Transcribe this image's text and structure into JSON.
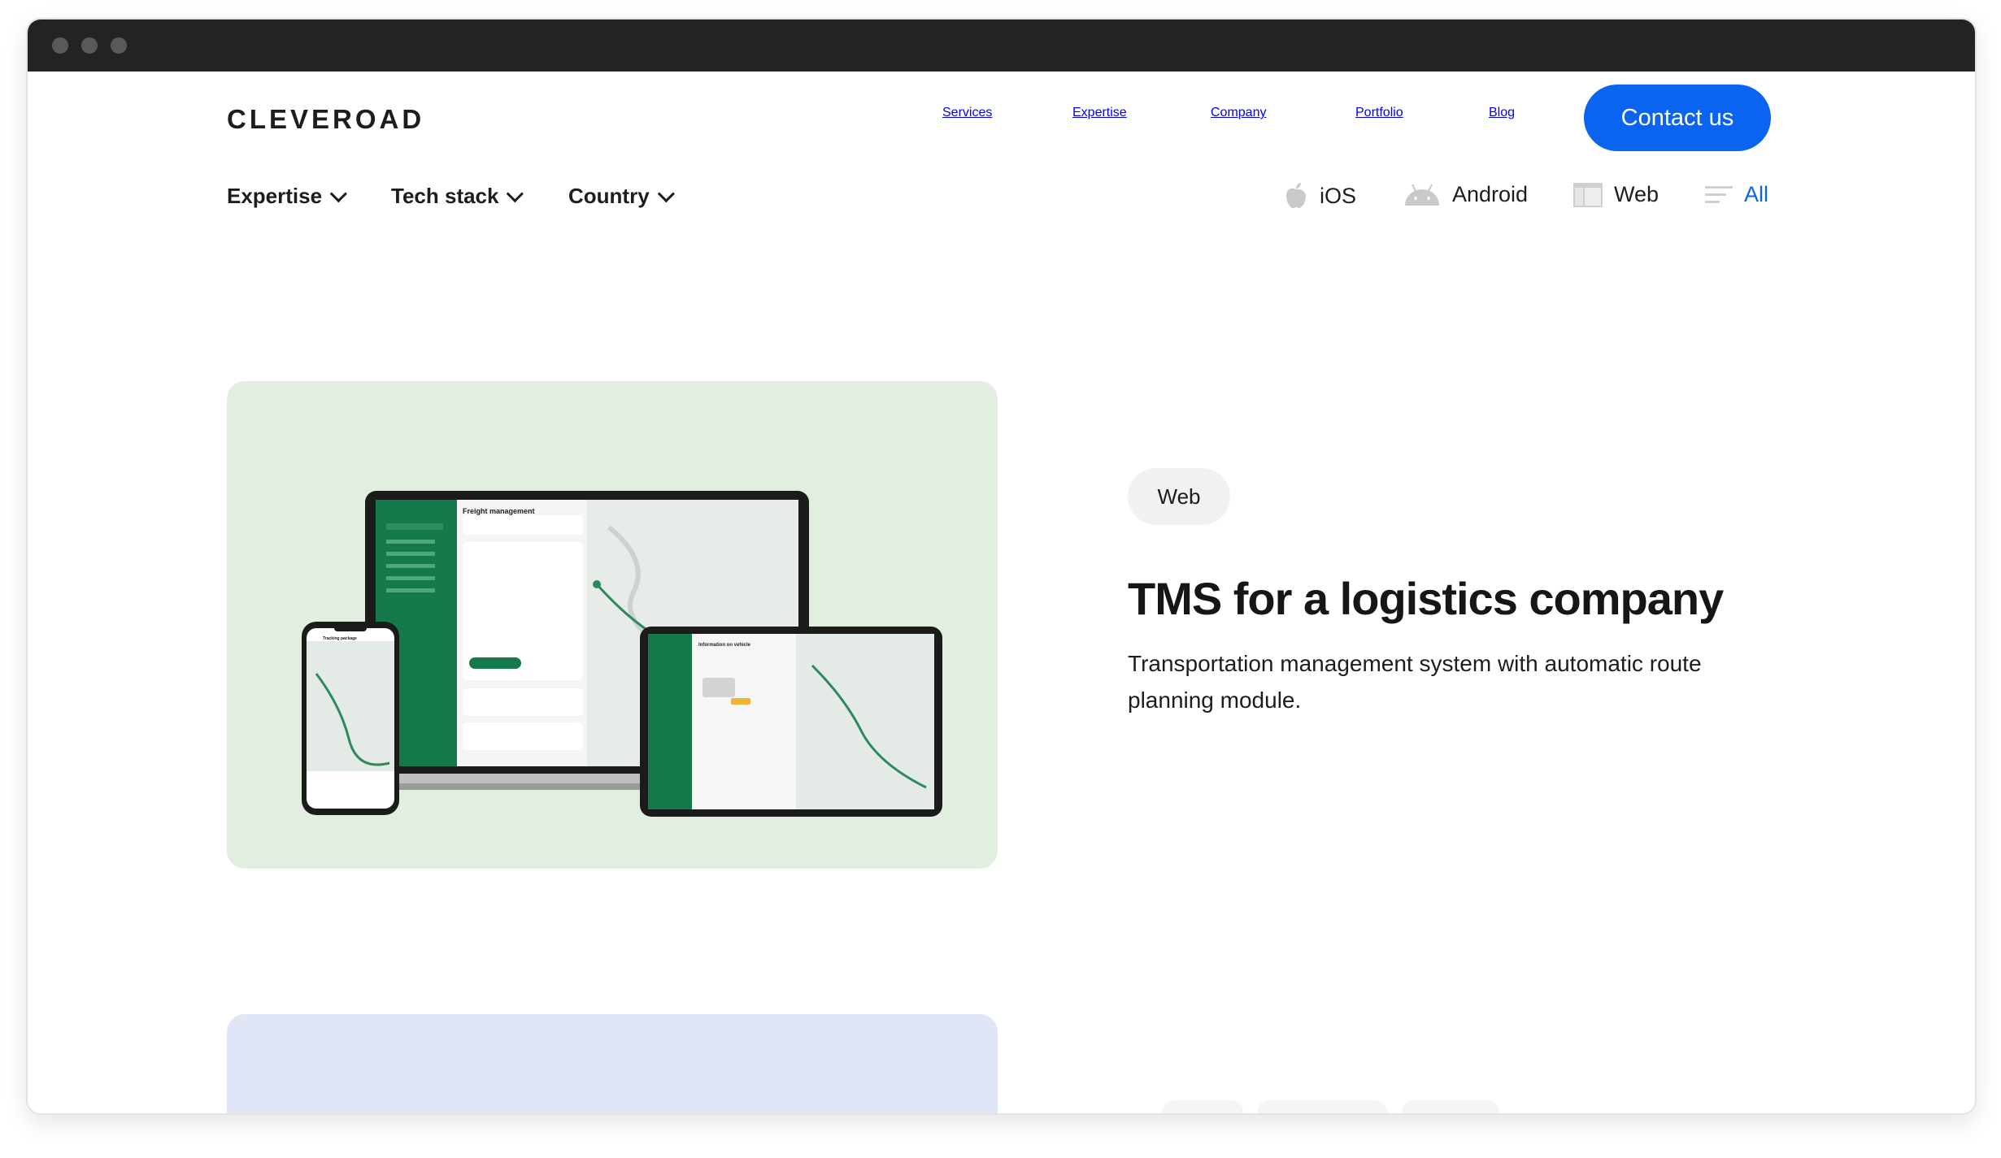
{
  "brand": {
    "logo": "CLEVEROAD"
  },
  "nav": {
    "items": [
      "Services",
      "Expertise",
      "Company",
      "Portfolio",
      "Blog"
    ],
    "contact": "Contact us"
  },
  "filters": [
    {
      "label": "Expertise"
    },
    {
      "label": "Tech stack"
    },
    {
      "label": "Country"
    }
  ],
  "platforms": [
    {
      "label": "iOS",
      "icon": "apple-icon"
    },
    {
      "label": "Android",
      "icon": "android-icon"
    },
    {
      "label": "Web",
      "icon": "web-icon"
    },
    {
      "label": "All",
      "icon": "all-icon",
      "active": true
    }
  ],
  "project": {
    "tag": "Web",
    "title": "TMS for a logistics company",
    "description": "Transportation management system with automatic route planning module."
  },
  "mockup": {
    "laptop_header": "Freight management",
    "tablet_header": "Information on vehicle",
    "phone_header": "Tracking package"
  },
  "colors": {
    "accent": "#0a64f0",
    "card_green": "#e2efe0",
    "card_blue": "#e1e6f6",
    "app_green": "#157a4b"
  }
}
